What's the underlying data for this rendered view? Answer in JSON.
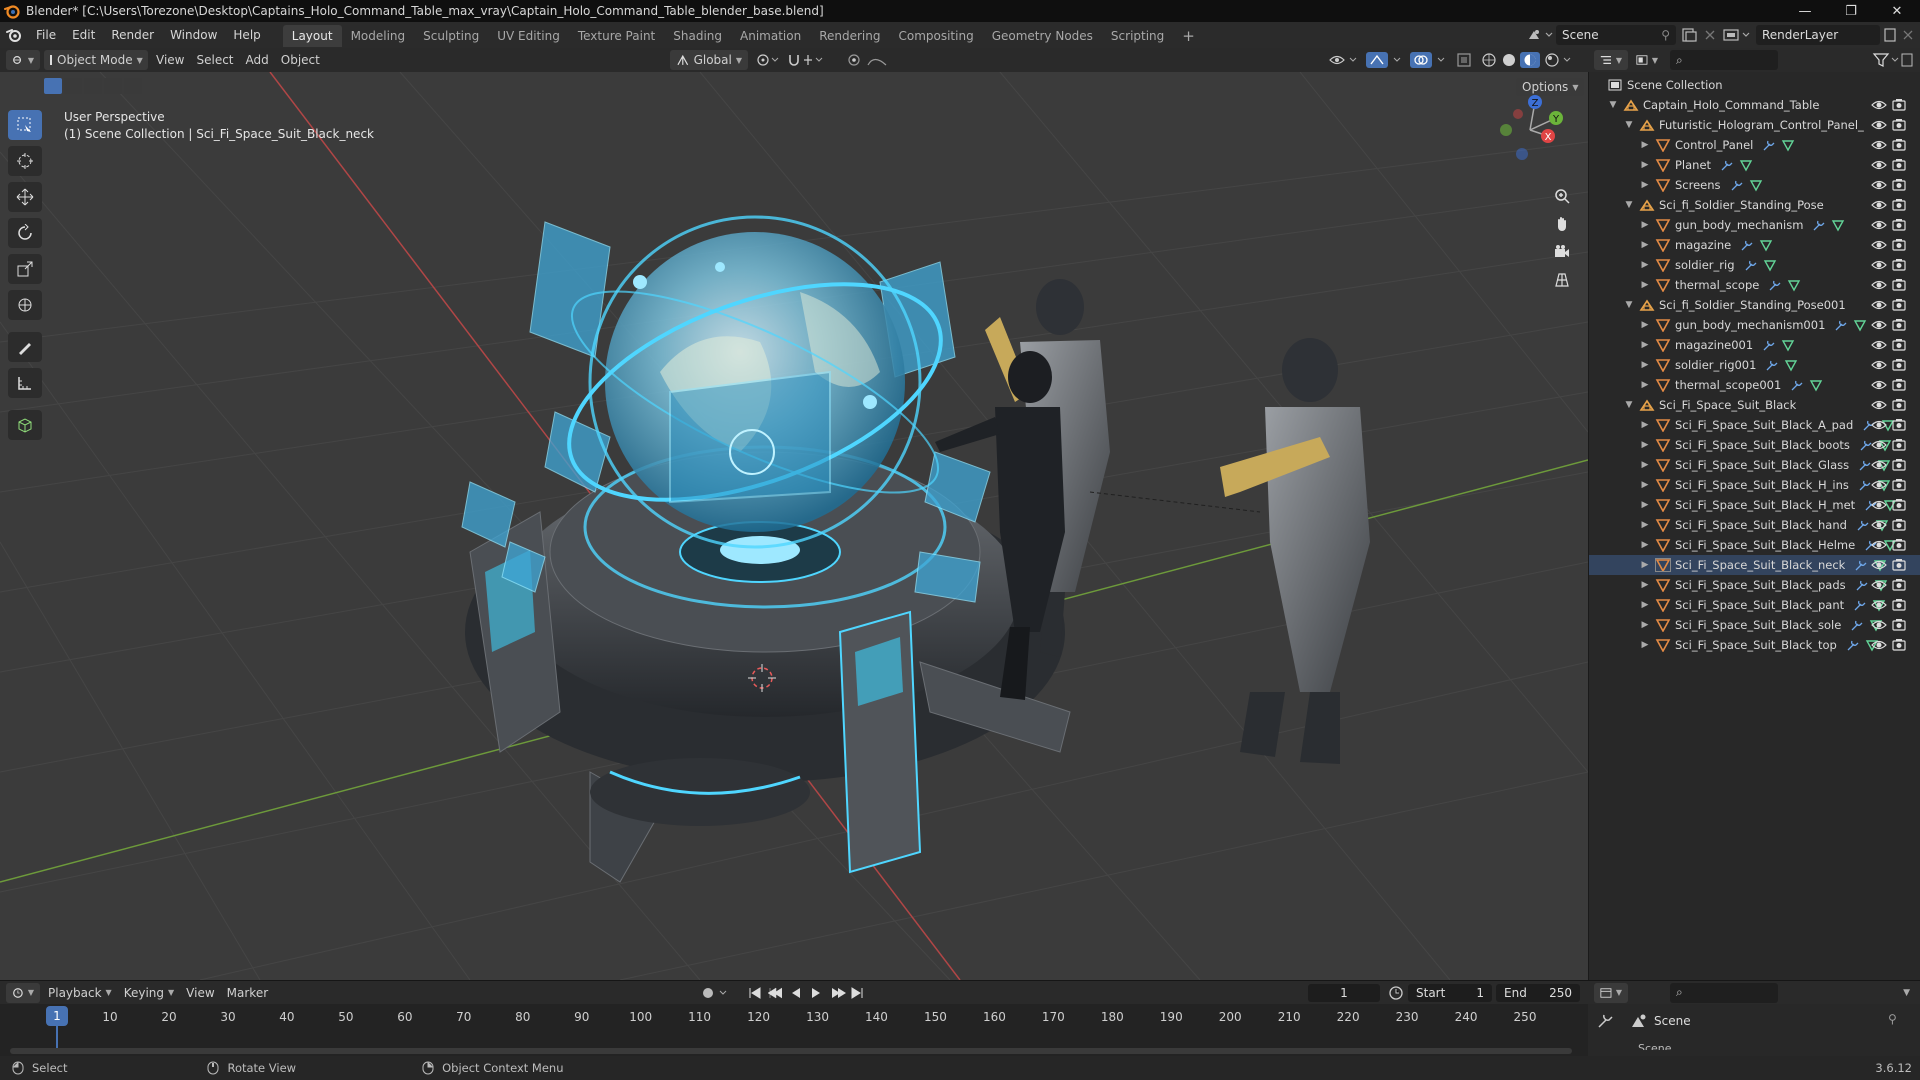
{
  "titlebar": {
    "title": "Blender* [C:\\Users\\Torezone\\Desktop\\Captains_Holo_Command_Table_max_vray\\Captain_Holo_Command_Table_blender_base.blend]",
    "minimize": "—",
    "restore": "❐",
    "close": "✕"
  },
  "menu": [
    "File",
    "Edit",
    "Render",
    "Window",
    "Help"
  ],
  "workspaces": [
    {
      "label": "Layout",
      "active": true
    },
    {
      "label": "Modeling"
    },
    {
      "label": "Sculpting"
    },
    {
      "label": "UV Editing"
    },
    {
      "label": "Texture Paint"
    },
    {
      "label": "Shading"
    },
    {
      "label": "Animation"
    },
    {
      "label": "Rendering"
    },
    {
      "label": "Compositing"
    },
    {
      "label": "Geometry Nodes"
    },
    {
      "label": "Scripting"
    }
  ],
  "add_workspace": "+",
  "scene_name": "Scene",
  "view_layer": "RenderLayer",
  "viewport_header": {
    "mode": "Object Mode",
    "menus": [
      "View",
      "Select",
      "Add",
      "Object"
    ],
    "transform_orientation": "Global",
    "options": "Options"
  },
  "viewport": {
    "perspective": "User Perspective",
    "context": "(1) Scene Collection | Sci_Fi_Space_Suit_Black_neck",
    "gizmo": {
      "z": "Z",
      "y": "Y",
      "x": "X"
    }
  },
  "outliner": {
    "root": "Scene Collection",
    "rows": [
      {
        "label": "Captain_Holo_Command_Table",
        "depth": 1,
        "type": "collection",
        "expanded": true
      },
      {
        "label": "Futuristic_Hologram_Control_Panel_",
        "depth": 2,
        "type": "collection",
        "expanded": true
      },
      {
        "label": "Control_Panel",
        "depth": 3,
        "type": "mesh"
      },
      {
        "label": "Planet",
        "depth": 3,
        "type": "mesh"
      },
      {
        "label": "Screens",
        "depth": 3,
        "type": "mesh"
      },
      {
        "label": "Sci_fi_Soldier_Standing_Pose",
        "depth": 2,
        "type": "collection",
        "expanded": true
      },
      {
        "label": "gun_body_mechanism",
        "depth": 3,
        "type": "mesh"
      },
      {
        "label": "magazine",
        "depth": 3,
        "type": "mesh"
      },
      {
        "label": "soldier_rig",
        "depth": 3,
        "type": "mesh"
      },
      {
        "label": "thermal_scope",
        "depth": 3,
        "type": "mesh"
      },
      {
        "label": "Sci_fi_Soldier_Standing_Pose001",
        "depth": 2,
        "type": "collection",
        "expanded": true
      },
      {
        "label": "gun_body_mechanism001",
        "depth": 3,
        "type": "mesh"
      },
      {
        "label": "magazine001",
        "depth": 3,
        "type": "mesh"
      },
      {
        "label": "soldier_rig001",
        "depth": 3,
        "type": "mesh"
      },
      {
        "label": "thermal_scope001",
        "depth": 3,
        "type": "mesh"
      },
      {
        "label": "Sci_Fi_Space_Suit_Black",
        "depth": 2,
        "type": "collection",
        "expanded": true
      },
      {
        "label": "Sci_Fi_Space_Suit_Black_A_pad",
        "depth": 3,
        "type": "mesh"
      },
      {
        "label": "Sci_Fi_Space_Suit_Black_boots",
        "depth": 3,
        "type": "mesh"
      },
      {
        "label": "Sci_Fi_Space_Suit_Black_Glass",
        "depth": 3,
        "type": "mesh"
      },
      {
        "label": "Sci_Fi_Space_Suit_Black_H_ins",
        "depth": 3,
        "type": "mesh"
      },
      {
        "label": "Sci_Fi_Space_Suit_Black_H_met",
        "depth": 3,
        "type": "mesh"
      },
      {
        "label": "Sci_Fi_Space_Suit_Black_hand",
        "depth": 3,
        "type": "mesh"
      },
      {
        "label": "Sci_Fi_Space_Suit_Black_Helme",
        "depth": 3,
        "type": "mesh"
      },
      {
        "label": "Sci_Fi_Space_Suit_Black_neck",
        "depth": 3,
        "type": "mesh",
        "selected": true
      },
      {
        "label": "Sci_Fi_Space_Suit_Black_pads",
        "depth": 3,
        "type": "mesh"
      },
      {
        "label": "Sci_Fi_Space_Suit_Black_pant",
        "depth": 3,
        "type": "mesh"
      },
      {
        "label": "Sci_Fi_Space_Suit_Black_sole",
        "depth": 3,
        "type": "mesh"
      },
      {
        "label": "Sci_Fi_Space_Suit_Black_top",
        "depth": 3,
        "type": "mesh"
      }
    ]
  },
  "properties": {
    "scene_label": "Scene",
    "sub_label": "Scene"
  },
  "timeline": {
    "menus": [
      "Playback",
      "Keying",
      "View",
      "Marker"
    ],
    "current_frame": "1",
    "start_label": "Start",
    "start": "1",
    "end_label": "End",
    "end": "250",
    "ticks": [
      "1",
      "10",
      "20",
      "30",
      "40",
      "50",
      "60",
      "70",
      "80",
      "90",
      "100",
      "110",
      "120",
      "130",
      "140",
      "150",
      "160",
      "170",
      "180",
      "190",
      "200",
      "210",
      "220",
      "230",
      "240",
      "250"
    ]
  },
  "statusbar": {
    "select": "Select",
    "rotate": "Rotate View",
    "context_menu": "Object Context Menu",
    "version": "3.6.12"
  },
  "colors": {
    "accent": "#4772b3",
    "collection_icon": "#e8a34a",
    "mesh_icon": "#e38a45",
    "modifier_icon": "#6ea6e8",
    "data_icon": "#62d497",
    "hologram": "#4fd6ff"
  }
}
